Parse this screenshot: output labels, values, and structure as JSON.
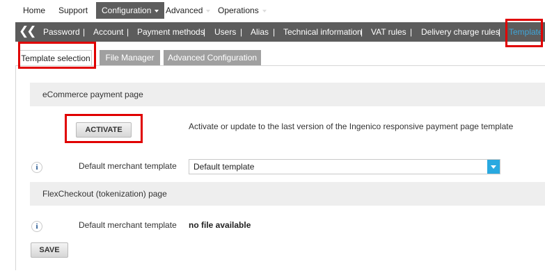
{
  "top_nav": {
    "home": "Home",
    "support": "Support",
    "configuration": "Configuration",
    "advanced": "Advanced",
    "operations": "Operations"
  },
  "sub_nav": {
    "items": [
      "Password",
      "Account",
      "Payment methods",
      "Users",
      "Alias",
      "Technical information",
      "VAT rules",
      "Delivery charge rules",
      "Template"
    ],
    "separator": "|",
    "current": "Template"
  },
  "tabs": [
    "Template selection",
    "File Manager",
    "Advanced Configuration"
  ],
  "ecommerce": {
    "heading": "eCommerce payment page",
    "activate_label": "ACTIVATE",
    "activate_description": "Activate or update to the last version of the Ingenico responsive payment page template",
    "merchant_label": "Default merchant template",
    "merchant_value": "Default template"
  },
  "flexcheckout": {
    "heading": "FlexCheckout (tokenization) page",
    "merchant_label": "Default merchant template",
    "merchant_value": "no file available"
  },
  "save_label": "SAVE",
  "info_glyph": "i",
  "colors": {
    "subnav_bg": "#5c5c5c",
    "active_link": "#3fa5d8",
    "select_arrow": "#29a9e0",
    "highlight": "#e00000"
  }
}
